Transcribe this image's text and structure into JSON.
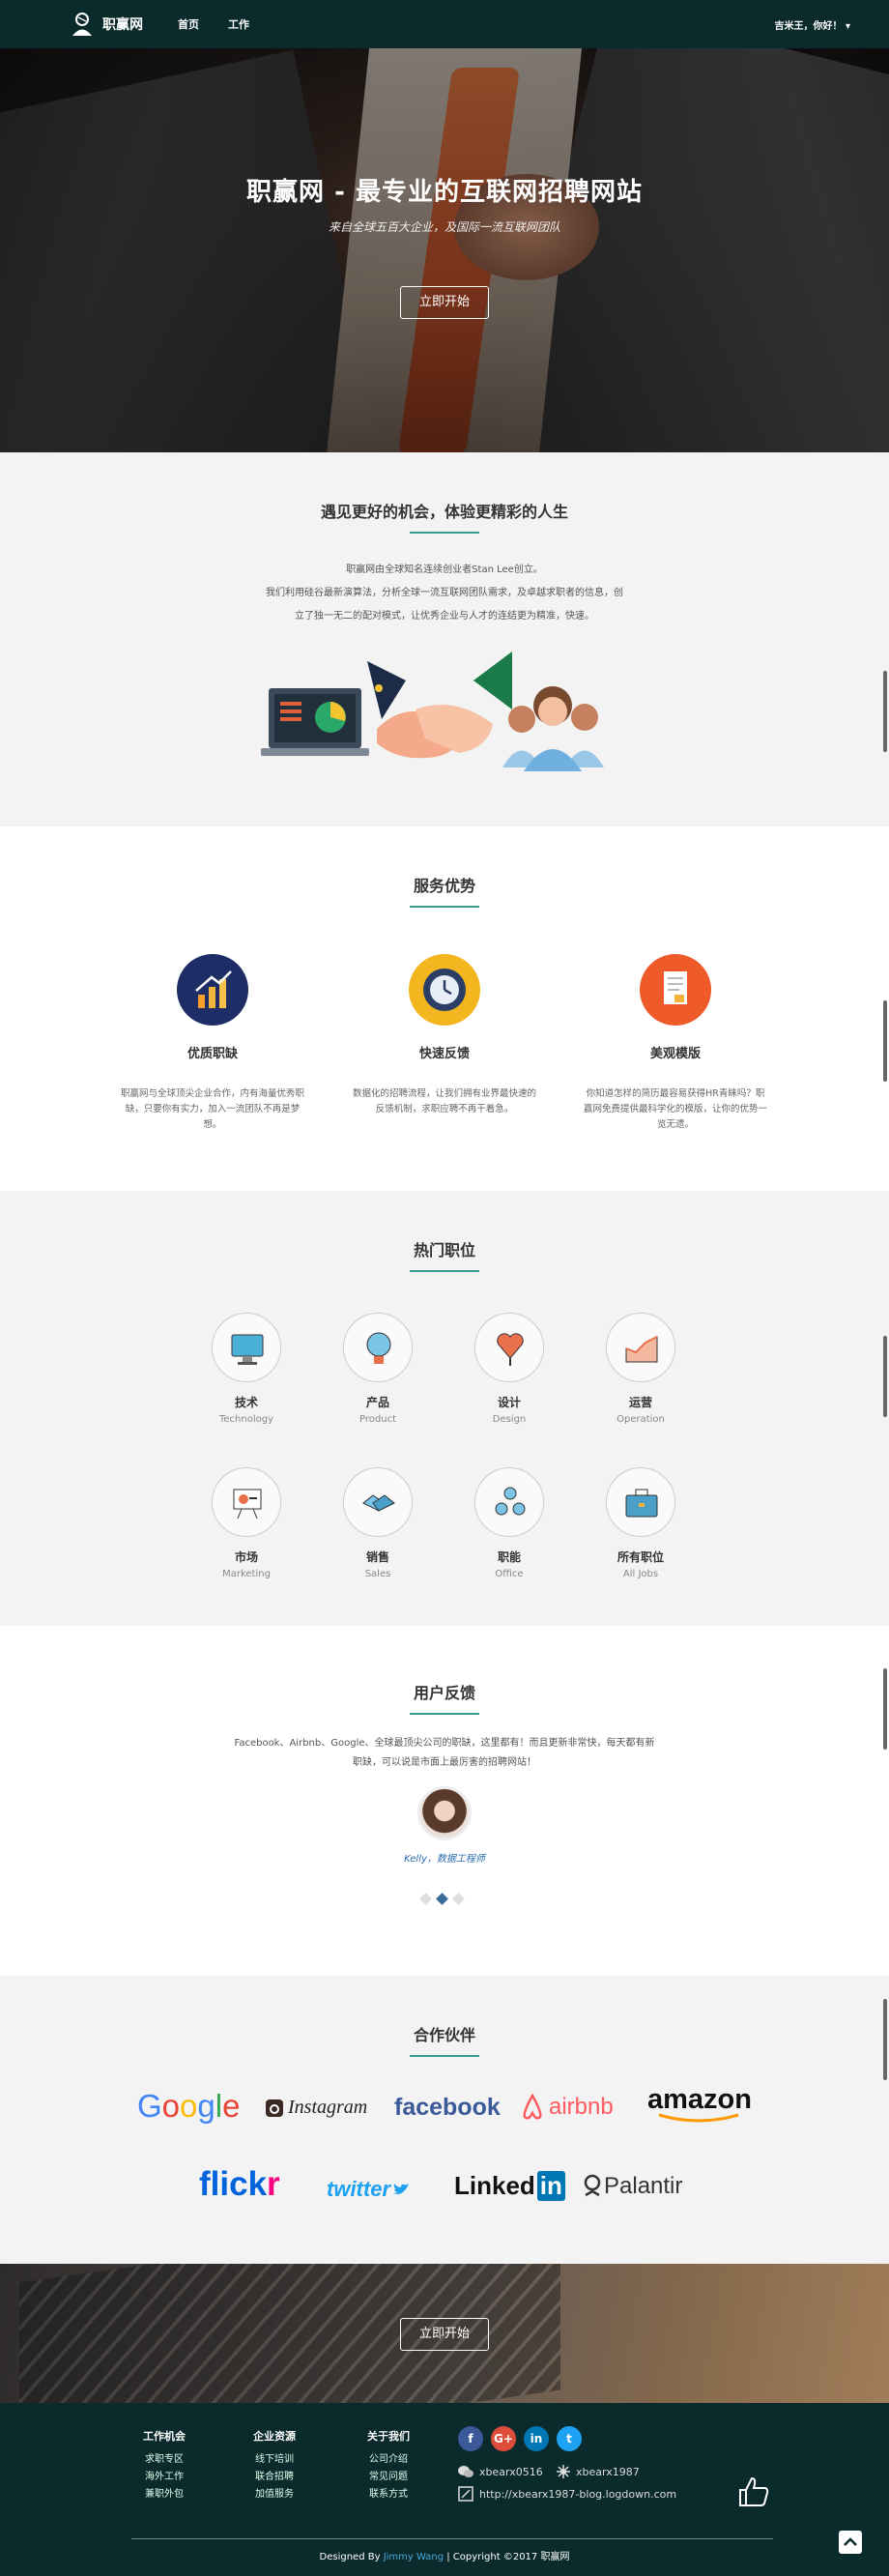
{
  "nav": {
    "brand": "职赢网",
    "links": [
      "首页",
      "工作"
    ],
    "user": "吉米王，你好！ ▾"
  },
  "hero": {
    "title": "职赢网 - 最专业的互联网招聘网站",
    "subtitle": "来自全球五百大企业，及国际一流互联网团队",
    "button": "立即开始"
  },
  "about": {
    "title": "遇见更好的机会，体验更精彩的人生",
    "lines": [
      "职赢网由全球知名连续创业者Stan Lee创立。",
      "我们利用硅谷最新演算法，分析全球一流互联网团队需求，及卓越求职者的信息，创",
      "立了独一无二的配对模式，让优秀企业与人才的连结更为精准，快速。"
    ]
  },
  "services": {
    "title": "服务优势",
    "items": [
      {
        "title": "优质职缺",
        "desc": "职赢网与全球顶尖企业合作，内有海量优秀职缺，只要你有实力，加入一流团队不再是梦想。",
        "icon": "chart-up-icon",
        "color": "#1e2d66"
      },
      {
        "title": "快速反馈",
        "desc": "数据化的招聘流程，让我们拥有业界最快速的反馈机制，求职应聘不再干着急。",
        "icon": "clock-gear-icon",
        "color": "#f3b61f"
      },
      {
        "title": "美观模版",
        "desc": "你知道怎样的简历最容易获得HR青睐吗？职赢网免费提供最科学化的模版，让你的优势一览无遗。",
        "icon": "document-icon",
        "color": "#ee5a2a"
      }
    ]
  },
  "jobs": {
    "title": "热门职位",
    "items": [
      {
        "cn": "技术",
        "en": "Technology",
        "icon": "monitor-icon"
      },
      {
        "cn": "产品",
        "en": "Product",
        "icon": "bulb-icon"
      },
      {
        "cn": "设计",
        "en": "Design",
        "icon": "pen-heart-icon"
      },
      {
        "cn": "运营",
        "en": "Operation",
        "icon": "growth-chart-icon"
      },
      {
        "cn": "市场",
        "en": "Marketing",
        "icon": "presentation-icon"
      },
      {
        "cn": "销售",
        "en": "Sales",
        "icon": "handshake-icon"
      },
      {
        "cn": "职能",
        "en": "Office",
        "icon": "team-icon"
      },
      {
        "cn": "所有职位",
        "en": "All Jobs",
        "icon": "briefcase-icon"
      }
    ]
  },
  "feedback": {
    "title": "用户反馈",
    "quote": "Facebook、Airbnb、Google、全球最顶尖公司的职缺，这里都有！而且更新非常快，每天都有新职缺，可以说是市面上最厉害的招聘网站！",
    "author": "Kelly，数据工程师"
  },
  "partners": {
    "title": "合作伙伴",
    "logos": [
      "Google",
      "Instagram",
      "facebook",
      "airbnb",
      "amazon",
      "flickr",
      "twitter",
      "Linked",
      "in",
      "Palantir"
    ]
  },
  "cta": {
    "button": "立即开始"
  },
  "footer": {
    "cols": [
      {
        "title": "工作机会",
        "items": [
          "求职专区",
          "海外工作",
          "兼职外包"
        ]
      },
      {
        "title": "企业资源",
        "items": [
          "线下培训",
          "联合招聘",
          "加值服务"
        ]
      },
      {
        "title": "关于我们",
        "items": [
          "公司介绍",
          "常见问题",
          "联系方式"
        ]
      }
    ],
    "social": [
      "f",
      "G+",
      "in",
      "t"
    ],
    "wechat": "xbearx0516",
    "qq": "xbearx1987",
    "blog": "http://xbearx1987-blog.logdown.com",
    "copy_prefix": "Designed By ",
    "copy_author": "Jimmy Wang",
    "copy_suffix": " | Copyright ©2017 职赢网"
  },
  "colors": {
    "nav": "#0b2a2c",
    "accent": "#3a9b93",
    "section_alt": "#f3f3f3"
  }
}
